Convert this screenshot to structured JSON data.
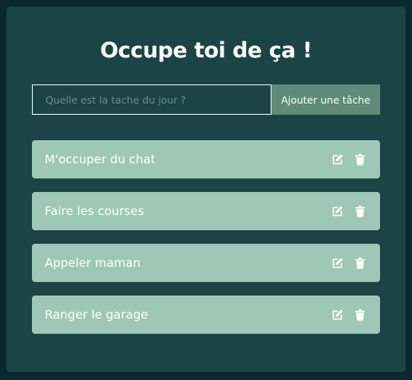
{
  "app": {
    "title": "Occupe toi de ça !"
  },
  "form": {
    "placeholder": "Quelle est la tache du jour ?",
    "value": "",
    "add_label": "Ajouter une tâche"
  },
  "todos": [
    {
      "text": "M'occuper du chat"
    },
    {
      "text": "Faire les courses"
    },
    {
      "text": "Appeler maman"
    },
    {
      "text": "Ranger le garage"
    }
  ],
  "icons": {
    "edit": "edit-icon",
    "delete": "trash-icon"
  },
  "colors": {
    "background": "#0b2730",
    "card": "#1b4446",
    "item": "#9dc8b8",
    "button": "#5f8b79",
    "text": "#ffffff"
  }
}
